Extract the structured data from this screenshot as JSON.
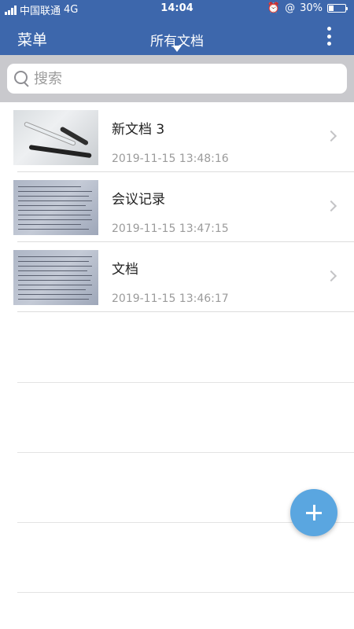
{
  "status_bar": {
    "carrier": "中国联通",
    "network": "4G",
    "time": "14:04",
    "battery": "30%"
  },
  "nav": {
    "menu_label": "菜单",
    "title": "所有文档",
    "more_icon": "more-vertical-icon"
  },
  "search": {
    "placeholder": "搜索",
    "value": ""
  },
  "documents": [
    {
      "name": "新文档 3",
      "date": "2019-11-15 13:48:16"
    },
    {
      "name": "会议记录",
      "date": "2019-11-15 13:47:15"
    },
    {
      "name": "文档",
      "date": "2019-11-15 13:46:17"
    }
  ],
  "colors": {
    "header": "#3d67ac",
    "search_bar_bg": "#c9c9cd",
    "fab": "#5aa6e0"
  }
}
